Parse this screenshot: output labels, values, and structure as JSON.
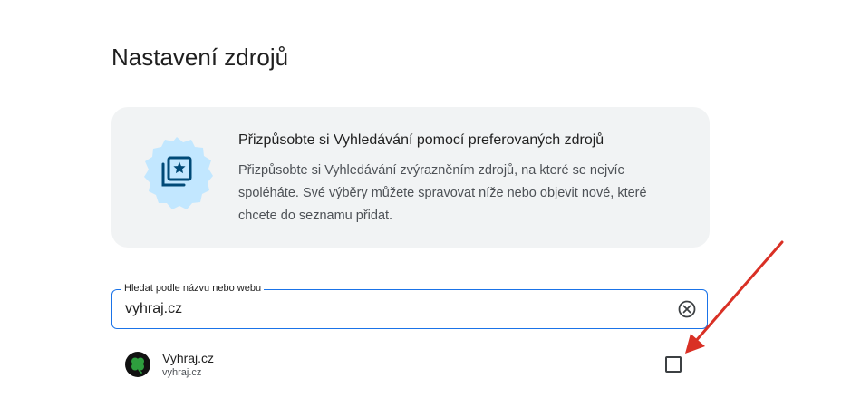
{
  "page": {
    "title": "Nastavení zdrojů"
  },
  "info_card": {
    "icon": "star-stack-icon",
    "heading": "Přizpůsobte si Vyhledávání pomocí preferovaných zdrojů",
    "body": "Přizpůsobte si Vyhledávání zvýrazněním zdrojů, na které se nejvíc spoléháte. Své výběry můžete spravovat níže nebo objevit nové, které chcete do seznamu přidat."
  },
  "search": {
    "label": "Hledat podle názvu nebo webu",
    "value": "vyhraj.cz",
    "clear_icon": "clear-circle-icon"
  },
  "results": [
    {
      "name": "Vyhraj.cz",
      "url": "vyhraj.cz",
      "logo_icon": "four-leaf-clover-icon",
      "checked": false
    }
  ],
  "annotation": {
    "color": "#d93025"
  },
  "colors": {
    "accent": "#1a73e8",
    "card_bg": "#f1f3f4",
    "badge_bg": "#c2e7ff",
    "badge_icon": "#004a77"
  }
}
